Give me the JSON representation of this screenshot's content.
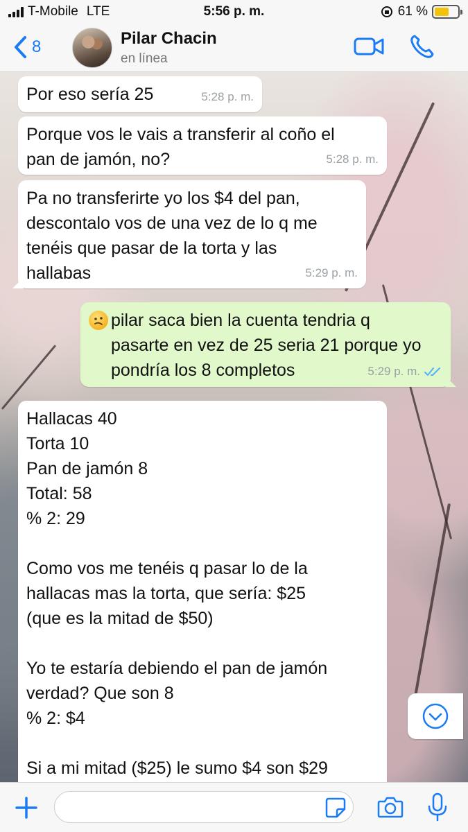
{
  "status_bar": {
    "carrier": "T-Mobile",
    "network": "LTE",
    "time": "5:56 p. m.",
    "battery_text": "61 %",
    "battery_level": 0.61
  },
  "header": {
    "back_count": "8",
    "contact_name": "Pilar Chacin",
    "contact_status": "en línea"
  },
  "messages": [
    {
      "text": "Por eso sería 25",
      "time": "5:28 p. m."
    },
    {
      "text": "Porque vos le vais a transferir al coño el\npan de jamón, no?",
      "time": "5:28 p. m."
    },
    {
      "text": "Pa no transferirte yo los $4 del pan,\ndescontalo vos de una vez de lo q me\ntenéis que pasar de la torta y las\nhallabas",
      "time": "5:29 p. m."
    },
    {
      "text": "pilar saca bien la cuenta tendria q\npasarte en vez de 25 seria 21 porque yo\npondría los 8 completos",
      "time": "5:29 p. m."
    },
    {
      "text": "Hallacas 40\nTorta 10\nPan de jamón 8\nTotal: 58\n% 2: 29\n\nComo vos me tenéis q pasar lo de la\nhallacas mas la torta, que sería: $25\n(que es la mitad de $50)\n\nYo te estaría debiendo el pan de jamón\nverdad? Que son 8\n% 2: $4\n\nSi a mi mitad ($25) le sumo $4 son $29"
    }
  ],
  "colors": {
    "accent": "#1a7bf5",
    "outgoing_bubble": "#e1f8cb",
    "incoming_bubble": "#ffffff",
    "read_ticks": "#4fb3f6"
  },
  "icons": [
    "back-chevron-icon",
    "video-call-icon",
    "phone-icon",
    "plus-icon",
    "sticker-icon",
    "camera-icon",
    "microphone-icon",
    "chevron-down-icon",
    "read-receipt-icon",
    "emoji-icon"
  ]
}
